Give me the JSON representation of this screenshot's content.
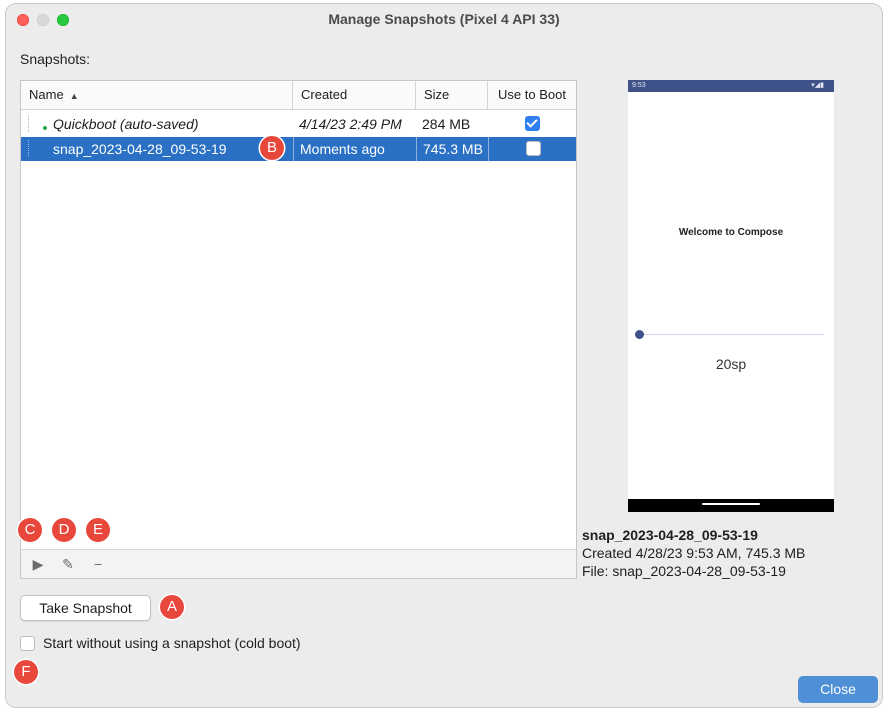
{
  "window": {
    "title": "Manage Snapshots (Pixel 4 API 33)"
  },
  "snapshots_label": "Snapshots:",
  "table": {
    "columns": [
      "Name",
      "Created",
      "Size",
      "Use to Boot"
    ],
    "sort_indicator": "▲",
    "rows": [
      {
        "name": "Quickboot (auto-saved)",
        "created": "4/14/23 2:49 PM",
        "size": "284 MB",
        "use_to_boot": true,
        "selected": false
      },
      {
        "name": "snap_2023-04-28_09-53-19",
        "created": "Moments ago",
        "size": "745.3 MB",
        "use_to_boot": false,
        "selected": true
      }
    ]
  },
  "toolbar": {
    "play_icon": "▶",
    "edit_icon": "✎",
    "remove_icon": "−"
  },
  "preview": {
    "status_time": "9:53",
    "status_icons": "▾◢▮",
    "welcome_text": "Welcome to Compose",
    "slider_value": 0.0,
    "size_text": "20sp"
  },
  "details": {
    "name": "snap_2023-04-28_09-53-19",
    "created": "Created 4/28/23 9:53 AM, 745.3 MB",
    "file": "File: snap_2023-04-28_09-53-19"
  },
  "buttons": {
    "take_snapshot": "Take Snapshot",
    "close": "Close"
  },
  "cold_boot": {
    "label": "Start without using a snapshot (cold boot)",
    "checked": false
  },
  "callouts": {
    "a": "A",
    "b": "B",
    "c": "C",
    "d": "D",
    "e": "E",
    "f": "F"
  },
  "colors": {
    "selection": "#2a70c4",
    "callout": "#e8473c",
    "phone_status_bar": "#3f5189",
    "close_button": "#4f8fd6"
  }
}
